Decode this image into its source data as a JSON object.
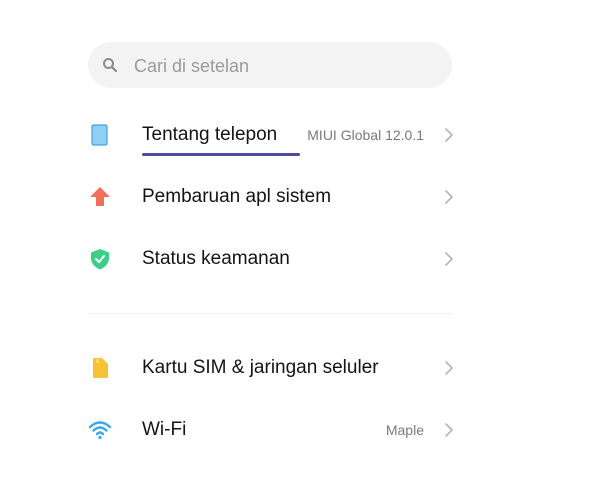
{
  "search": {
    "placeholder": "Cari di setelan"
  },
  "items": [
    {
      "label": "Tentang telepon",
      "value": "MIUI Global 12.0.1"
    },
    {
      "label": "Pembaruan apl sistem",
      "value": ""
    },
    {
      "label": "Status keamanan",
      "value": ""
    },
    {
      "label": "Kartu SIM & jaringan seluler",
      "value": ""
    },
    {
      "label": "Wi-Fi",
      "value": "Maple"
    }
  ],
  "colors": {
    "phone_icon": "#8ecff5",
    "update_icon": "#f0705a",
    "security_icon": "#3ccf8a",
    "sim_icon": "#f7c233",
    "wifi_icon": "#3aa6e8",
    "underline": "#4e4a9e"
  }
}
